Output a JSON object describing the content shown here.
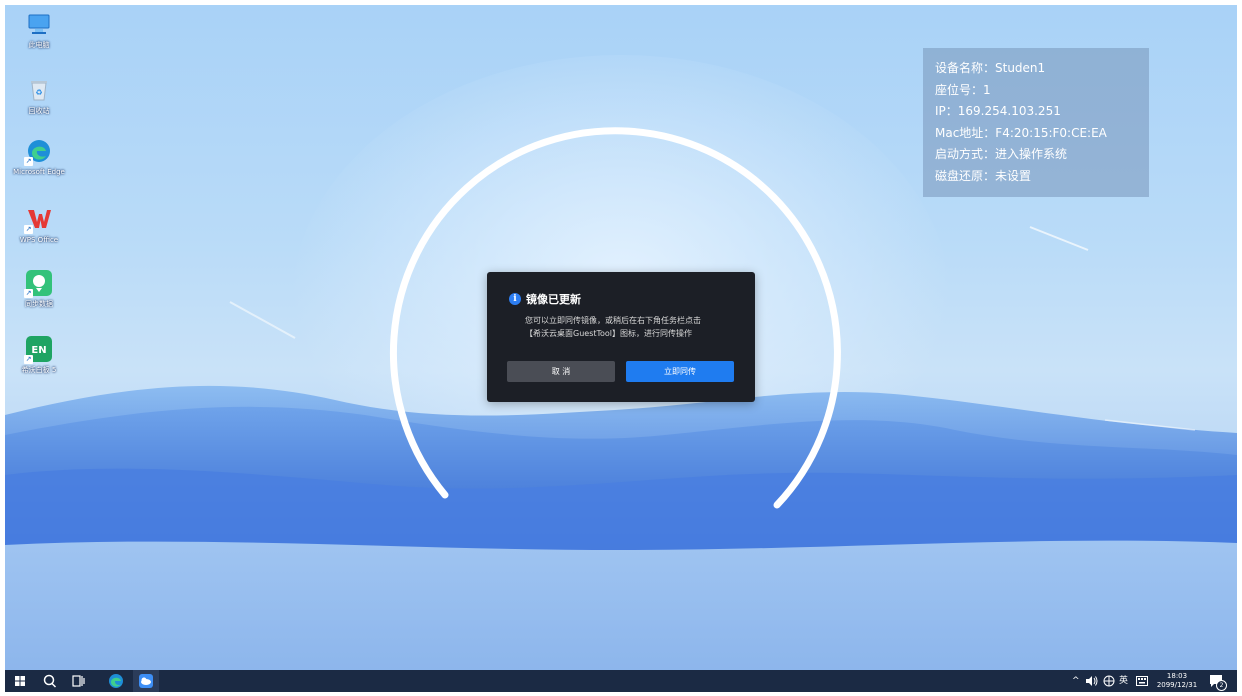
{
  "desktop": {
    "icons": [
      {
        "label": "此电脑",
        "icon": "computer-icon"
      },
      {
        "label": "回收站",
        "icon": "recycle-bin-icon"
      },
      {
        "label": "Microsoft Edge",
        "icon": "edge-icon"
      },
      {
        "label": "WPS Office",
        "icon": "wps-office-icon"
      },
      {
        "label": "同步数据",
        "icon": "sync-data-icon"
      },
      {
        "label": "希沃白板 5",
        "icon": "seewo-whiteboard-icon"
      }
    ]
  },
  "info_panel": {
    "rows": [
      "设备名称：Studen1",
      "座位号：1",
      "IP：169.254.103.251",
      "Mac地址：F4:20:15:F0:CE:EA",
      "启动方式：进入操作系统",
      "磁盘还原：未设置"
    ]
  },
  "dialog": {
    "title": "镜像已更新",
    "message_line1": "您可以立即同传镜像，或稍后在右下角任务栏点击",
    "message_line2": "【希沃云桌面GuestTool】图标，进行同传操作",
    "cancel_label": "取 消",
    "confirm_label": "立即同传",
    "accent_color": "#1f7cf0"
  },
  "taskbar": {
    "items": [
      "start-icon",
      "search-icon",
      "task-view-icon",
      "edge-icon",
      "guesttool-icon"
    ],
    "tray": {
      "chevron": "^",
      "volume_icon": "volume-icon",
      "ime_icon": "ime-icon",
      "language": "英",
      "keyboard_icon": "keyboard-icon",
      "time": "18:03",
      "date": "2099/12/31",
      "notification_count": "2"
    }
  }
}
